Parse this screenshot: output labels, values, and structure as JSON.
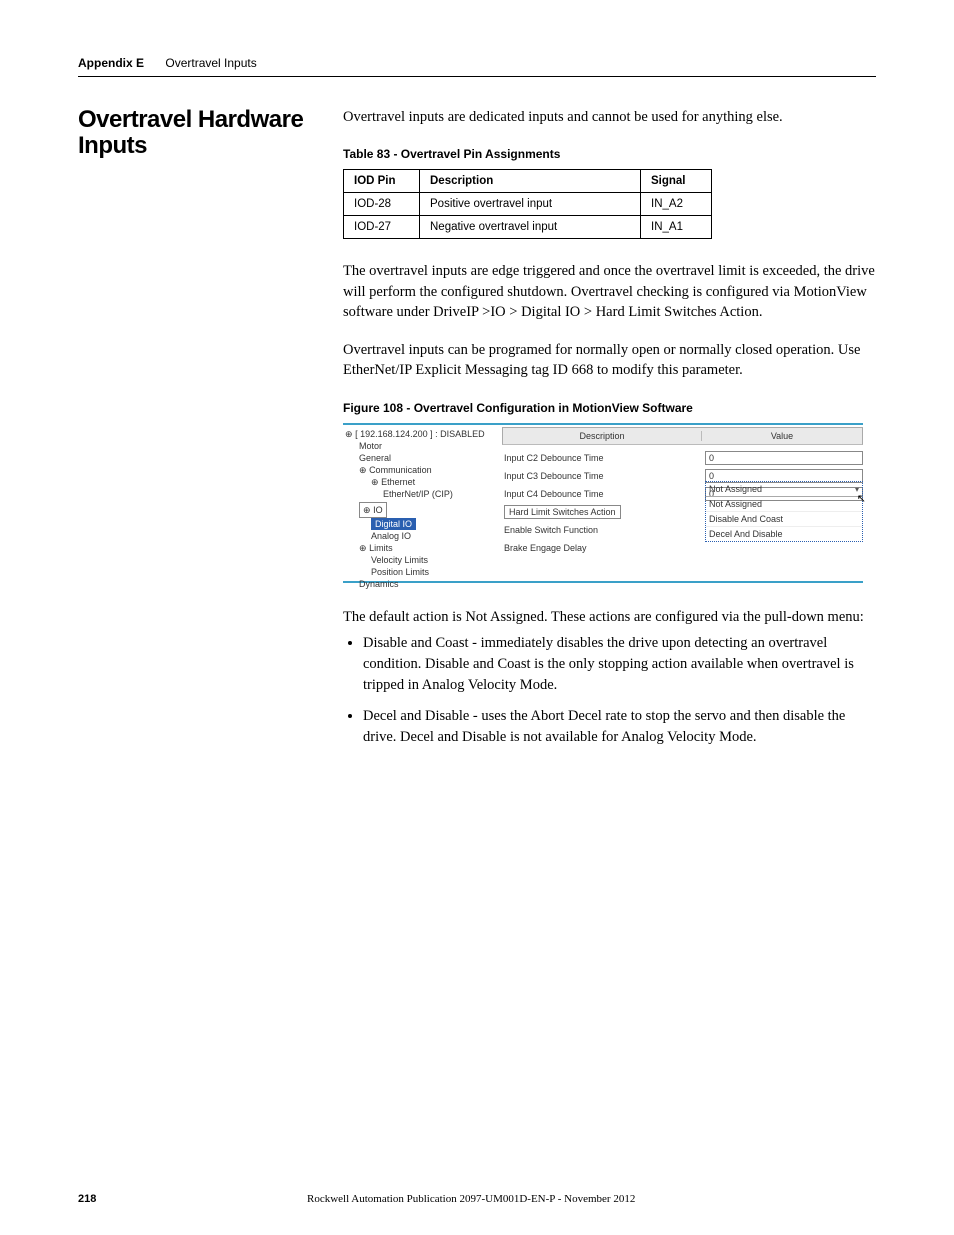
{
  "header": {
    "appendix": "Appendix E",
    "subject": "Overtravel Inputs"
  },
  "section_title": "Overtravel Hardware Inputs",
  "intro_para": "Overtravel inputs are dedicated inputs and cannot be used for anything else.",
  "table_caption": "Table 83 - Overtravel Pin Assignments",
  "table": {
    "headers": {
      "c1": "IOD Pin",
      "c2": "Description",
      "c3": "Signal"
    },
    "rows": [
      {
        "c1": "IOD-28",
        "c2": "Positive overtravel input",
        "c3": "IN_A2"
      },
      {
        "c1": "IOD-27",
        "c2": "Negative overtravel input",
        "c3": "IN_A1"
      }
    ]
  },
  "para2": "The overtravel inputs are edge triggered and once the overtravel limit is exceeded, the drive will perform the configured shutdown. Overtravel checking is configured via MotionView software under DriveIP >IO > Digital IO > Hard Limit Switches Action.",
  "para3": "Overtravel inputs can be programed for normally open or normally closed operation. Use EtherNet/IP Explicit Messaging tag ID 668 to modify this parameter.",
  "figure_caption": "Figure 108 - Overtravel Configuration in MotionView Software",
  "figure": {
    "tree": {
      "root": "[ 192.168.124.200 ]  : DISABLED",
      "motor": "Motor",
      "general": "General",
      "communication": "Communication",
      "ethernet": "Ethernet",
      "enetip": "EtherNet/IP (CIP)",
      "io": "IO",
      "digital_io": "Digital IO",
      "analog_io": "Analog IO",
      "limits": "Limits",
      "velocity_limits": "Velocity Limits",
      "position_limits": "Position Limits",
      "dynamics": "Dynamics"
    },
    "headers": {
      "desc": "Description",
      "value": "Value"
    },
    "rows": {
      "r1d": "Input C2 Debounce Time",
      "r1v": "0",
      "r2d": "Input C3 Debounce Time",
      "r2v": "0",
      "r3d": "Input C4 Debounce Time",
      "r3v": "0",
      "r4d": "Hard Limit Switches Action",
      "r5d": "Enable Switch Function",
      "r6d": "Brake Engage Delay"
    },
    "dropdown": {
      "selected": "Not Assigned",
      "opt1": "Not Assigned",
      "opt2": "Disable And Coast",
      "opt3": "Decel And Disable"
    }
  },
  "para4": "The default action is Not Assigned. These actions are configured via the pull-down menu:",
  "bullets": {
    "b1": "Disable and Coast - immediately disables the drive upon detecting an overtravel condition. Disable and Coast is the only stopping action available when overtravel is tripped in Analog Velocity Mode.",
    "b2": "Decel and Disable - uses the Abort Decel rate to stop the servo and then disable the drive. Decel and Disable is not available for Analog Velocity Mode."
  },
  "footer": {
    "page": "218",
    "pub": "Rockwell Automation Publication 2097-UM001D-EN-P - November 2012"
  }
}
